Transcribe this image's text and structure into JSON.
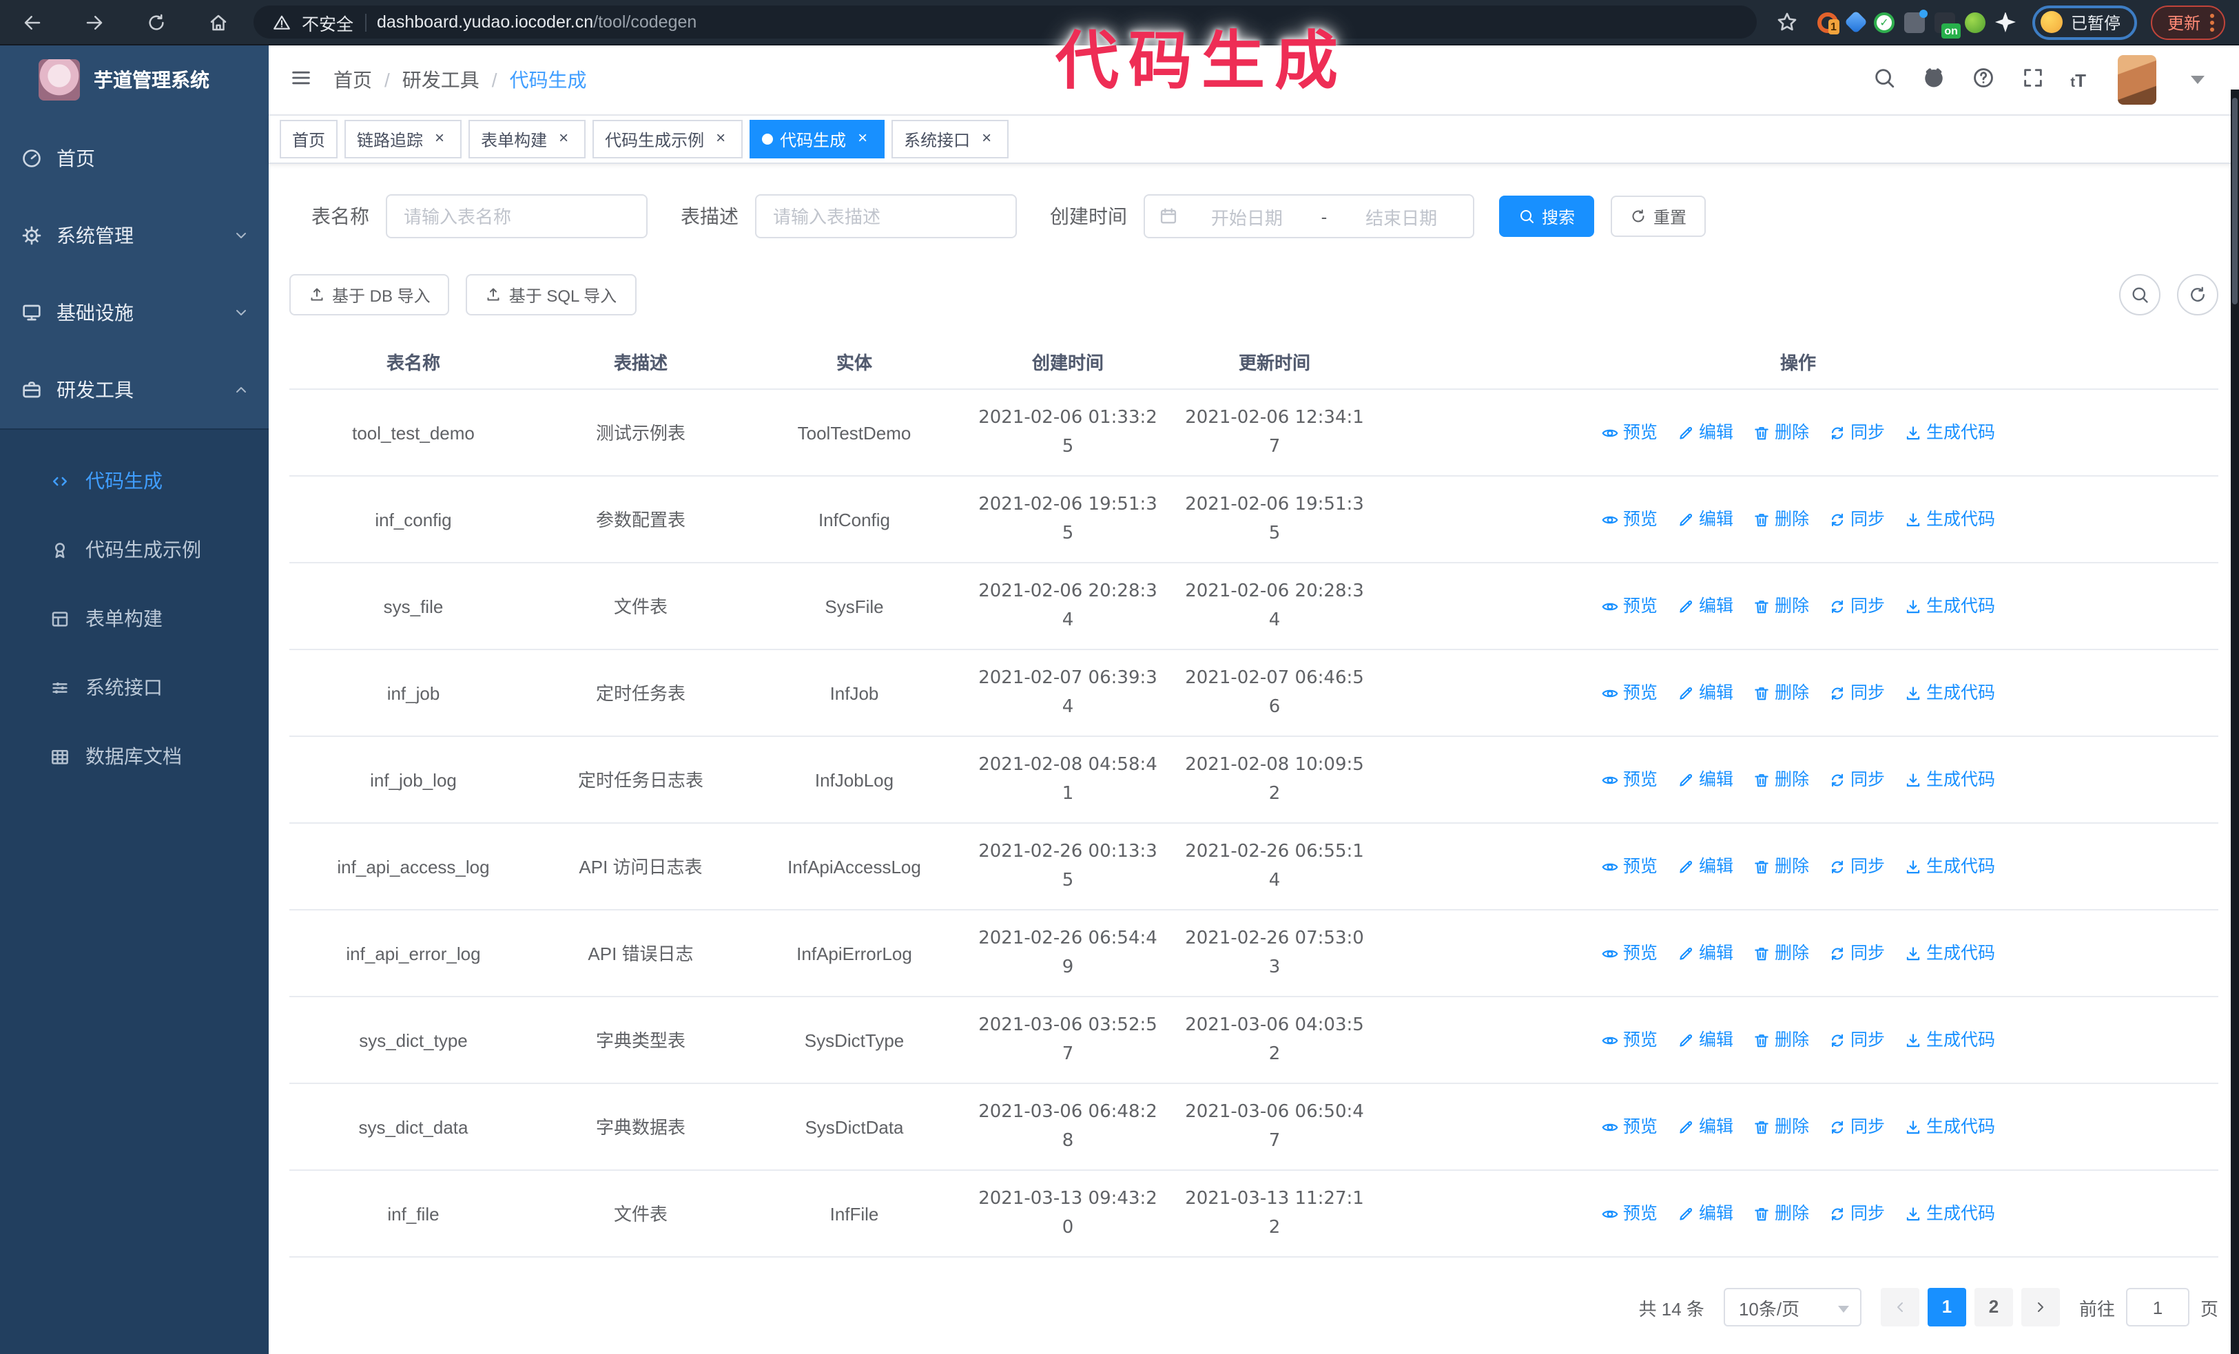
{
  "browser": {
    "security_label": "不安全",
    "url_domain": "dashboard.yudao.iocoder.cn",
    "url_path": "/tool/codegen",
    "paused_label": "已暂停",
    "update_label": "更新",
    "extensions": [
      {
        "name": "orange-swirl",
        "badge": "1"
      },
      {
        "name": "blue-gem",
        "badge": null
      },
      {
        "name": "green-check-circle",
        "badge": null
      },
      {
        "name": "gray-sliders",
        "badge": null
      },
      {
        "name": "dark-box-on",
        "badge": "on"
      },
      {
        "name": "green-bug",
        "badge": null
      },
      {
        "name": "white-pinwheel",
        "badge": null
      }
    ]
  },
  "annotation": {
    "text": "代码生成",
    "color": "#ee2d55"
  },
  "sidebar": {
    "logo_title": "芋道管理系统",
    "items": [
      {
        "label": "首页",
        "icon": "dashboard",
        "expandable": false,
        "expanded": false
      },
      {
        "label": "系统管理",
        "icon": "gear",
        "expandable": true,
        "expanded": false
      },
      {
        "label": "基础设施",
        "icon": "monitor",
        "expandable": true,
        "expanded": false
      },
      {
        "label": "研发工具",
        "icon": "tools",
        "expandable": true,
        "expanded": true
      }
    ],
    "submenu": [
      {
        "label": "代码生成",
        "icon": "code",
        "active": true
      },
      {
        "label": "代码生成示例",
        "icon": "medal",
        "active": false
      },
      {
        "label": "表单构建",
        "icon": "form",
        "active": false
      },
      {
        "label": "系统接口",
        "icon": "api",
        "active": false
      },
      {
        "label": "数据库文档",
        "icon": "db",
        "active": false
      }
    ]
  },
  "header": {
    "breadcrumb": [
      "首页",
      "研发工具",
      "代码生成"
    ],
    "separator": "/"
  },
  "tabs": [
    {
      "label": "首页",
      "closable": false,
      "active": false
    },
    {
      "label": "链路追踪",
      "closable": true,
      "active": false
    },
    {
      "label": "表单构建",
      "closable": true,
      "active": false
    },
    {
      "label": "代码生成示例",
      "closable": true,
      "active": false
    },
    {
      "label": "代码生成",
      "closable": true,
      "active": true
    },
    {
      "label": "系统接口",
      "closable": true,
      "active": false
    }
  ],
  "filters": {
    "table_name_label": "表名称",
    "table_name_placeholder": "请输入表名称",
    "table_desc_label": "表描述",
    "table_desc_placeholder": "请输入表描述",
    "create_time_label": "创建时间",
    "date_start_placeholder": "开始日期",
    "date_separator": "-",
    "date_end_placeholder": "结束日期",
    "search_button": "搜索",
    "reset_button": "重置"
  },
  "toolbar": {
    "import_db": "基于 DB 导入",
    "import_sql": "基于 SQL 导入"
  },
  "table": {
    "columns": [
      "表名称",
      "表描述",
      "实体",
      "创建时间",
      "更新时间",
      "操作"
    ],
    "actions": [
      {
        "label": "预览",
        "icon": "eye"
      },
      {
        "label": "编辑",
        "icon": "edit"
      },
      {
        "label": "删除",
        "icon": "trash"
      },
      {
        "label": "同步",
        "icon": "sync"
      },
      {
        "label": "生成代码",
        "icon": "download"
      }
    ],
    "rows": [
      {
        "name": "tool_test_demo",
        "desc": "测试示例表",
        "entity": "ToolTestDemo",
        "created": "2021-02-06 01:33:25",
        "updated": "2021-02-06 12:34:17"
      },
      {
        "name": "inf_config",
        "desc": "参数配置表",
        "entity": "InfConfig",
        "created": "2021-02-06 19:51:35",
        "updated": "2021-02-06 19:51:35"
      },
      {
        "name": "sys_file",
        "desc": "文件表",
        "entity": "SysFile",
        "created": "2021-02-06 20:28:34",
        "updated": "2021-02-06 20:28:34"
      },
      {
        "name": "inf_job",
        "desc": "定时任务表",
        "entity": "InfJob",
        "created": "2021-02-07 06:39:34",
        "updated": "2021-02-07 06:46:56"
      },
      {
        "name": "inf_job_log",
        "desc": "定时任务日志表",
        "entity": "InfJobLog",
        "created": "2021-02-08 04:58:41",
        "updated": "2021-02-08 10:09:52"
      },
      {
        "name": "inf_api_access_log",
        "desc": "API 访问日志表",
        "entity": "InfApiAccessLog",
        "created": "2021-02-26 00:13:35",
        "updated": "2021-02-26 06:55:14"
      },
      {
        "name": "inf_api_error_log",
        "desc": "API 错误日志",
        "entity": "InfApiErrorLog",
        "created": "2021-02-26 06:54:49",
        "updated": "2021-02-26 07:53:03"
      },
      {
        "name": "sys_dict_type",
        "desc": "字典类型表",
        "entity": "SysDictType",
        "created": "2021-03-06 03:52:57",
        "updated": "2021-03-06 04:03:52"
      },
      {
        "name": "sys_dict_data",
        "desc": "字典数据表",
        "entity": "SysDictData",
        "created": "2021-03-06 06:48:28",
        "updated": "2021-03-06 06:50:47"
      },
      {
        "name": "inf_file",
        "desc": "文件表",
        "entity": "InfFile",
        "created": "2021-03-13 09:43:20",
        "updated": "2021-03-13 11:27:12"
      }
    ]
  },
  "pagination": {
    "total_text": "共 14 条",
    "page_size": "10条/页",
    "pages": [
      "1",
      "2"
    ],
    "active_page": "1",
    "goto_label": "前往",
    "goto_value": "1",
    "goto_suffix": "页"
  },
  "colors": {
    "primary": "#1890ff",
    "sidebar_bg": "#2c4c6f",
    "submenu_bg": "#223f5f",
    "active_link": "#409eff",
    "annotation": "#ee2d55",
    "chrome_bg": "#212b36"
  },
  "icons": {
    "search": "magnifier",
    "github": "octocat",
    "help": "question-circle",
    "fullscreen": "expand-corners",
    "font-size": "tT",
    "hamburger": "three-bars",
    "eye": "preview",
    "edit": "pencil",
    "trash": "delete",
    "sync": "two-arrows-circle",
    "download": "arrow-into-tray",
    "upload": "arrow-out-of-tray",
    "calendar": "calendar",
    "warning": "triangle-exclamation",
    "star": "bookmark-star"
  }
}
